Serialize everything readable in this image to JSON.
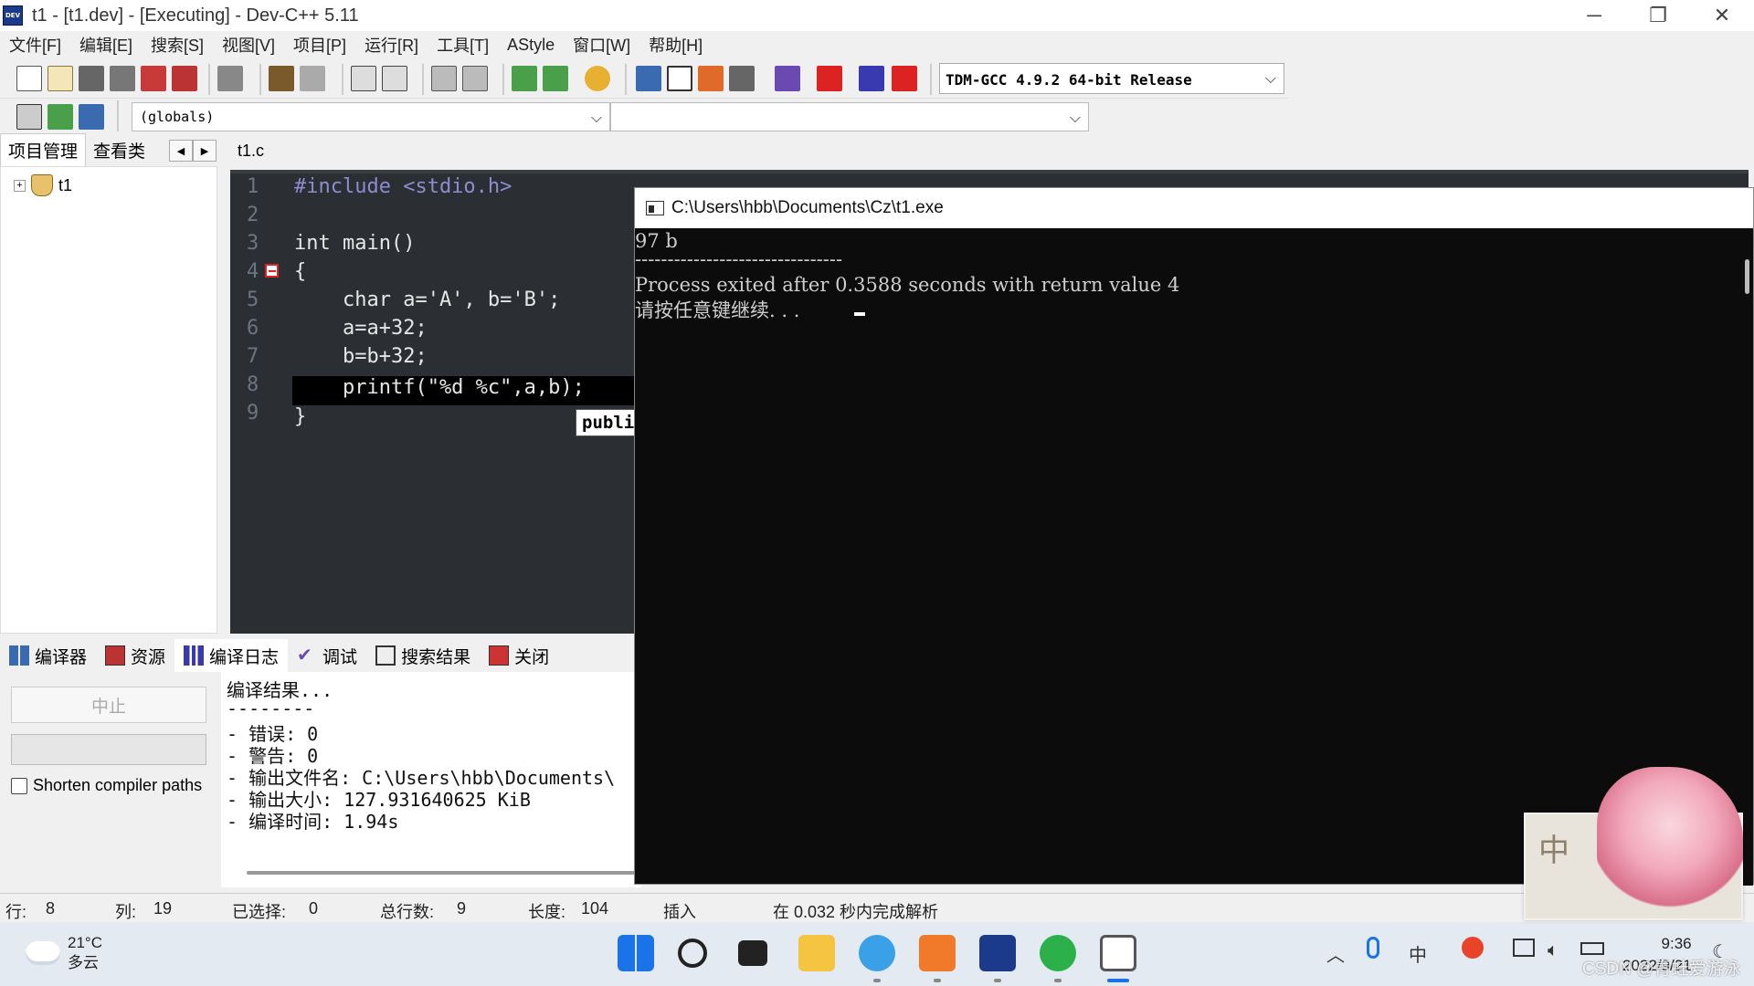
{
  "window": {
    "title": "t1 - [t1.dev] - [Executing] - Dev-C++ 5.11",
    "app_icon_text": "DEV",
    "controls": [
      "─",
      "❐",
      "✕"
    ]
  },
  "menu": [
    "文件[F]",
    "编辑[E]",
    "搜索[S]",
    "视图[V]",
    "项目[P]",
    "运行[R]",
    "工具[T]",
    "AStyle",
    "窗口[W]",
    "帮助[H]"
  ],
  "toolbar": {
    "compiler": "TDM-GCC 4.9.2 64-bit Release",
    "scope_combo": "(globals)",
    "member_combo": ""
  },
  "left_panel": {
    "tabs": [
      "项目管理",
      "查看类"
    ],
    "tree": {
      "expander": "+",
      "project": "t1"
    }
  },
  "editor": {
    "tab": "t1.c",
    "line_numbers": [
      "1",
      "2",
      "3",
      "4",
      "5",
      "6",
      "7",
      "8",
      "9"
    ],
    "lines": [
      "#include <stdio.h>",
      "",
      "int main()",
      "{",
      "    char a='A', b='B';",
      "    a=a+32;",
      "    b=b+32;",
      "    printf(\"%d %c\",a,b);",
      "}"
    ],
    "tooltip": "public int __cdecl printf"
  },
  "bottom_panel": {
    "tabs": [
      "编译器",
      "资源",
      "编译日志",
      "调试",
      "搜索结果",
      "关闭"
    ],
    "abort_label": "中止",
    "shorten_label": "Shorten compiler paths",
    "log": [
      "编译结果...",
      "--------",
      "- 错误: 0",
      "- 警告: 0",
      "- 输出文件名: C:\\Users\\hbb\\Documents\\",
      "- 输出大小: 127.931640625 KiB",
      "- 编译时间: 1.94s"
    ]
  },
  "console": {
    "title": "C:\\Users\\hbb\\Documents\\Cz\\t1.exe",
    "output": [
      "97 b",
      "--------------------------------",
      "Process exited after 0.3588 seconds with return value 4",
      "请按任意键继续. . . "
    ]
  },
  "status": {
    "row_label": "行:",
    "row": "8",
    "col_label": "列:",
    "col": "19",
    "sel_label": "已选择:",
    "sel": "0",
    "lines_label": "总行数:",
    "lines": "9",
    "len_label": "长度:",
    "len": "104",
    "mode": "插入",
    "parse": "在 0.032 秒内完成解析"
  },
  "taskbar": {
    "temp": "21°C",
    "weather": "多云",
    "time": "9:36",
    "date": "2022/9/21",
    "ime": "中",
    "watermark": "CSDN @青蛙爱游泳"
  },
  "pet": {
    "char": "中"
  }
}
